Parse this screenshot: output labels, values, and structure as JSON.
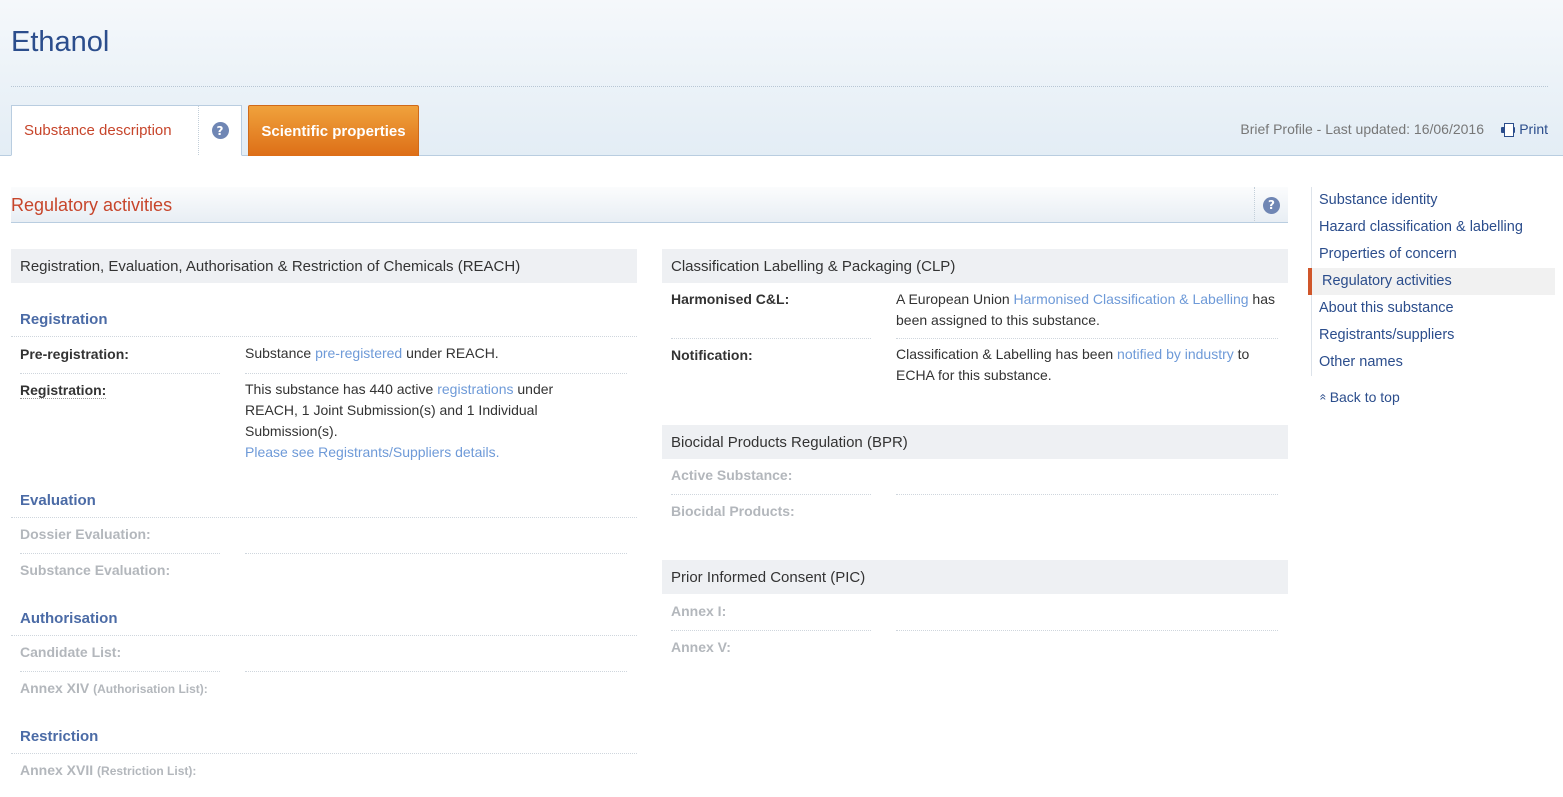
{
  "page": {
    "title": "Ethanol"
  },
  "tabs": {
    "description": "Substance description",
    "scientific": "Scientific properties"
  },
  "meta": {
    "updated": "Brief Profile - Last updated: 16/06/2016",
    "print": "Print"
  },
  "section": {
    "title": "Regulatory activities"
  },
  "reach": {
    "title": "Registration, Evaluation, Authorisation & Restriction of Chemicals (REACH)",
    "registration": {
      "heading": "Registration",
      "pre_label": "Pre-registration:",
      "pre_a": "Substance ",
      "pre_link": "pre-registered",
      "pre_b": " under REACH.",
      "reg_label": "Registration:",
      "reg_a": "This substance has 440 active ",
      "reg_link": "registrations",
      "reg_b": " under REACH, 1 Joint Submission(s) and 1 Individual Submission(s).",
      "reg_details": "Please see Registrants/Suppliers details."
    },
    "evaluation": {
      "heading": "Evaluation",
      "dossier": "Dossier Evaluation:",
      "substance": "Substance Evaluation:"
    },
    "authorisation": {
      "heading": "Authorisation",
      "candidate": "Candidate List:",
      "annex_main": "Annex XIV",
      "annex_small": "(Authorisation List):"
    },
    "restriction": {
      "heading": "Restriction",
      "annex_main": "Annex XVII",
      "annex_small": "(Restriction List):"
    }
  },
  "clp": {
    "title": "Classification Labelling & Packaging (CLP)",
    "harm_label": "Harmonised C&L:",
    "harm_a": "A European Union ",
    "harm_link": "Harmonised Classification & Labelling",
    "harm_b": " has been assigned to this substance.",
    "notif_label": "Notification:",
    "notif_a": "Classification & Labelling has been ",
    "notif_link": "notified by industry",
    "notif_b": " to ECHA for this substance."
  },
  "bpr": {
    "title": "Biocidal Products Regulation (BPR)",
    "active": "Active Substance:",
    "products": "Biocidal Products:"
  },
  "pic": {
    "title": "Prior Informed Consent (PIC)",
    "annex1": "Annex I:",
    "annex5": "Annex V:"
  },
  "nav": {
    "items": [
      {
        "label": "Substance identity"
      },
      {
        "label": "Hazard classification & labelling"
      },
      {
        "label": "Properties of concern"
      },
      {
        "label": "Regulatory activities"
      },
      {
        "label": "About this substance"
      },
      {
        "label": "Registrants/suppliers"
      },
      {
        "label": "Other names"
      }
    ],
    "back_to_top": "Back to top"
  },
  "icons": {
    "help": "?",
    "back": "«"
  },
  "colors": {
    "brand_blue": "#2b4d8c",
    "accent_red": "#c7452b",
    "tab_orange": "#e98324",
    "link": "#6e9ad8"
  }
}
